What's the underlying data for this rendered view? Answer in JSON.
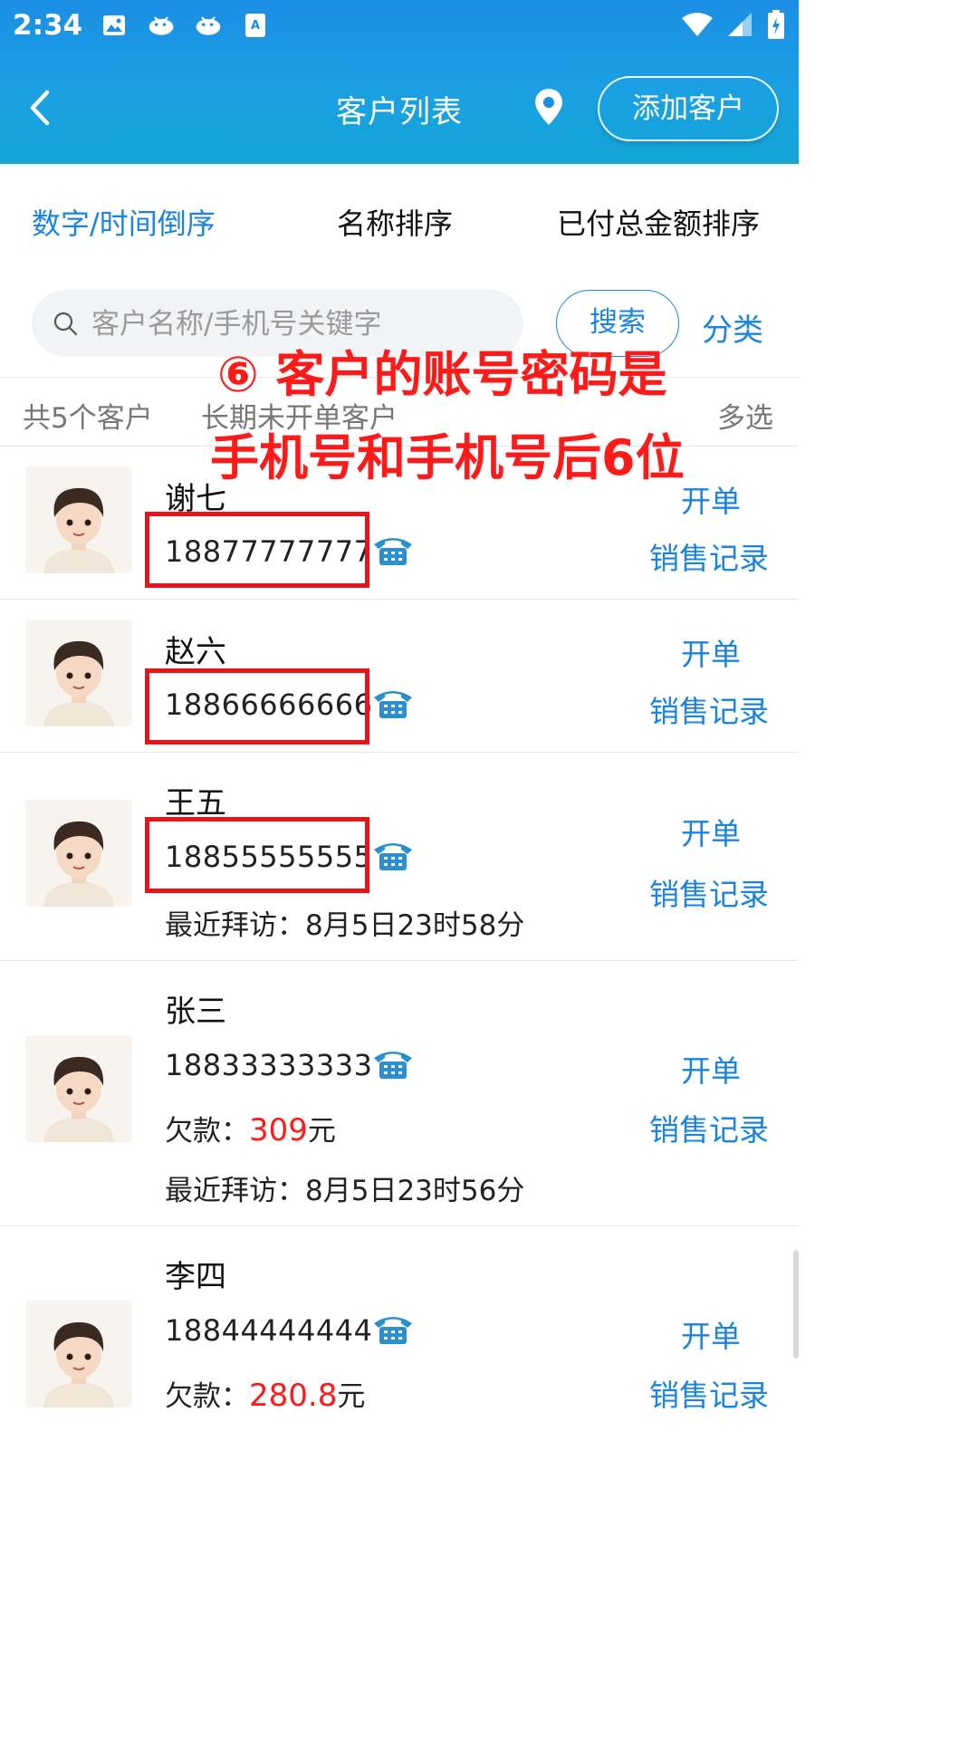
{
  "status_bar": {
    "time": "2:34"
  },
  "header": {
    "title": "客户列表",
    "add_button": "添加客户"
  },
  "sort_tabs": [
    {
      "label": "数字/时间倒序",
      "active": true
    },
    {
      "label": "名称排序",
      "active": false
    },
    {
      "label": "已付总金额排序",
      "active": false
    }
  ],
  "search": {
    "placeholder": "客户名称/手机号关键字",
    "button": "搜索",
    "category": "分类"
  },
  "summary": {
    "count": "共5个客户",
    "inactive": "长期未开单客户",
    "multi_select": "多选"
  },
  "annotation": {
    "line1": "⑥ 客户的账号密码是",
    "line2": "手机号和手机号后6位"
  },
  "customers": [
    {
      "name": "谢七",
      "phone": "18877777777",
      "order": "开单",
      "sales": "销售记录"
    },
    {
      "name": "赵六",
      "phone": "18866666666",
      "order": "开单",
      "sales": "销售记录"
    },
    {
      "name": "王五",
      "phone": "18855555555",
      "visit_label": "最近拜访：",
      "visit": "8月5日23时58分",
      "order": "开单",
      "sales": "销售记录"
    },
    {
      "name": "张三",
      "phone": "18833333333",
      "debt_label": "欠款：",
      "debt": "309",
      "debt_unit": "元",
      "visit_label": "最近拜访：",
      "visit": "8月5日23时56分",
      "order": "开单",
      "sales": "销售记录"
    },
    {
      "name": "李四",
      "phone": "18844444444",
      "debt_label": "欠款：",
      "debt": "280.8",
      "debt_unit": "元",
      "order": "开单",
      "sales": "销售记录"
    }
  ],
  "colors": {
    "accent": "#1a84e0",
    "header": "#1b8ee4",
    "alert": "#ff1a1a"
  },
  "icons": [
    "back-arrow-icon",
    "location-pin-icon",
    "search-icon",
    "telephone-icon",
    "image-icon",
    "whale-app-icon",
    "keyboard-app-icon",
    "wifi-icon",
    "signal-icon",
    "battery-icon"
  ]
}
